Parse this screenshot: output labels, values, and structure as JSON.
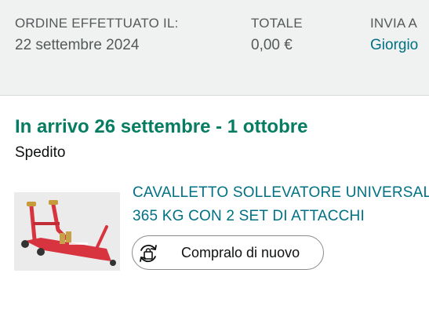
{
  "order_header": {
    "order_placed_label": "ORDINE EFFETTUATO IL:",
    "order_placed_value": "22 settembre 2024",
    "total_label": "TOTALE",
    "total_value": "0,00 €",
    "ship_to_label": "INVIA A",
    "ship_to_value": "Giorgio"
  },
  "shipment": {
    "delivery_title": "In arrivo 26 settembre - 1 ottobre",
    "status": "Spedito"
  },
  "product": {
    "title_line1": "CAVALLETTO SOLLEVATORE UNIVERSALE",
    "title_line2": "365 KG CON 2 SET DI ATTACCHI",
    "image_icon": "motorcycle-stand-image"
  },
  "actions": {
    "buy_again_label": "Compralo di nuovo",
    "buy_again_icon": "buy-again-icon"
  },
  "colors": {
    "header_bg": "#f0f2f2",
    "link": "#007185",
    "delivery_green": "#067d62",
    "stand_red": "#d8343f"
  }
}
